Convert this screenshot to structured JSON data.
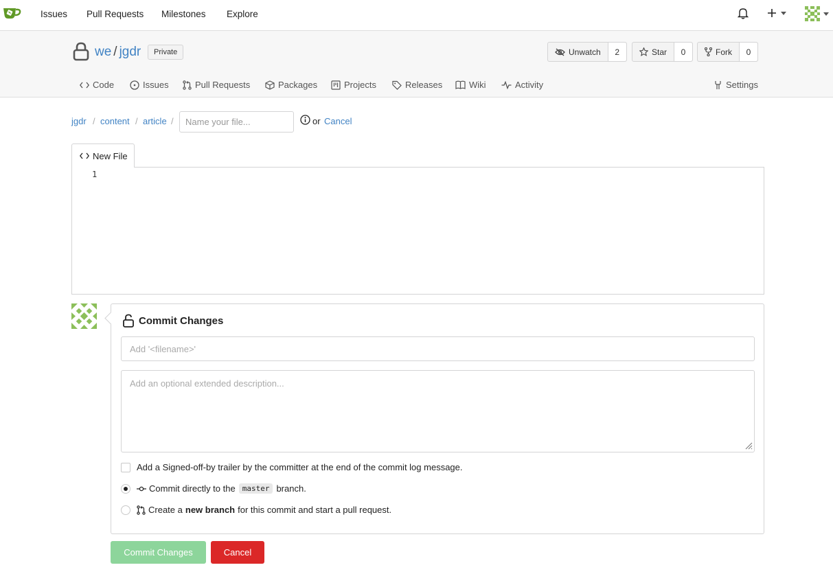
{
  "topnav": {
    "items": [
      "Issues",
      "Pull Requests",
      "Milestones",
      "Explore"
    ],
    "brand_color": "#609926"
  },
  "repo": {
    "owner": "we",
    "separator": "/",
    "name": "jgdr",
    "visibility": "Private",
    "watch": {
      "label": "Unwatch",
      "count": "2"
    },
    "star": {
      "label": "Star",
      "count": "0"
    },
    "fork": {
      "label": "Fork",
      "count": "0"
    },
    "tabs": [
      "Code",
      "Issues",
      "Pull Requests",
      "Packages",
      "Projects",
      "Releases",
      "Wiki",
      "Activity"
    ],
    "settings": "Settings"
  },
  "breadcrumb": {
    "parts": [
      "jgdr",
      "content",
      "article"
    ],
    "separator": "/",
    "filename_placeholder": "Name your file...",
    "or": "or",
    "cancel": "Cancel"
  },
  "editor": {
    "tab_label": "New File",
    "line_number": "1"
  },
  "commit": {
    "title": "Commit Changes",
    "summary_placeholder": "Add '<filename>'",
    "description_placeholder": "Add an optional extended description...",
    "signoff_label": "Add a Signed-off-by trailer by the committer at the end of the commit log message.",
    "direct_prefix": "Commit directly to the",
    "branch_name": "master",
    "direct_suffix": "branch.",
    "new_branch_prefix": "Create a",
    "new_branch_bold": "new branch",
    "new_branch_suffix": "for this commit and start a pull request.",
    "submit_label": "Commit Changes",
    "cancel_label": "Cancel",
    "submit_color": "#8dd59b",
    "cancel_color": "#db2828"
  }
}
